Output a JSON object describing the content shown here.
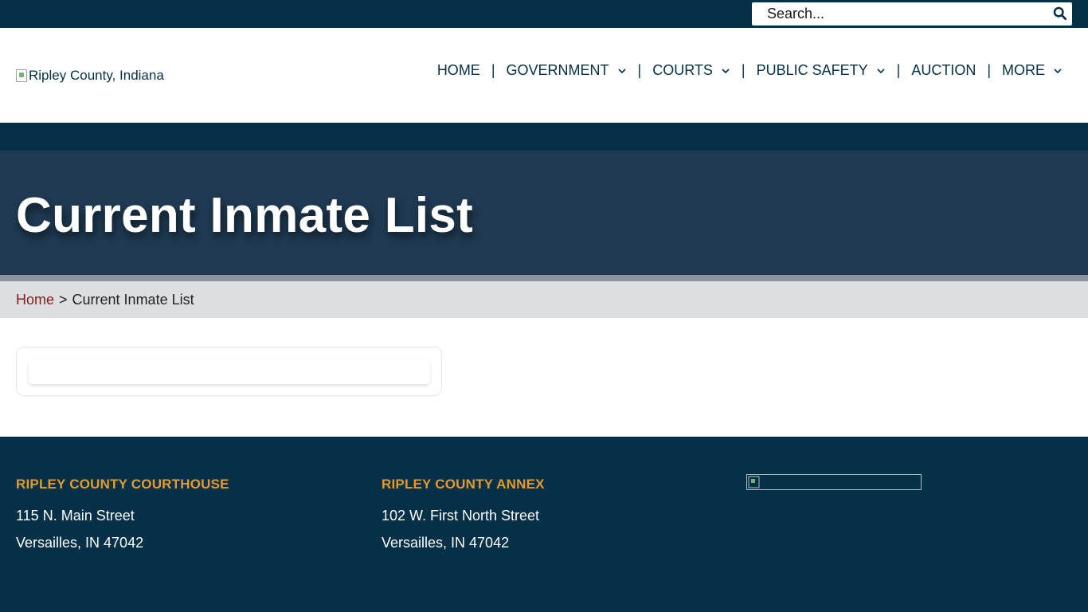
{
  "search": {
    "placeholder": "Search..."
  },
  "logo": {
    "alt_text": "Ripley County, Indiana"
  },
  "nav": {
    "items": [
      {
        "label": "HOME",
        "has_dropdown": false
      },
      {
        "label": "GOVERNMENT",
        "has_dropdown": true
      },
      {
        "label": "COURTS",
        "has_dropdown": true
      },
      {
        "label": "PUBLIC SAFETY",
        "has_dropdown": true
      },
      {
        "label": "AUCTION",
        "has_dropdown": false
      },
      {
        "label": "MORE",
        "has_dropdown": true
      }
    ],
    "separator": "|"
  },
  "page": {
    "title": "Current Inmate List"
  },
  "breadcrumb": {
    "home": "Home",
    "separator": ">",
    "current": "Current Inmate List"
  },
  "footer": {
    "courthouse": {
      "heading": "RIPLEY COUNTY COURTHOUSE",
      "address1": "115 N. Main Street",
      "address2": "Versailles, IN 47042"
    },
    "annex": {
      "heading": "RIPLEY COUNTY ANNEX",
      "address1": "102 W. First North Street",
      "address2": "Versailles, IN 47042"
    }
  },
  "colors": {
    "navy": "#043048",
    "hero": "#1f3a52",
    "accent_orange": "#e69a2e",
    "link_red": "#8b1a1a",
    "breadcrumb_bg": "#dcdfe2"
  },
  "icons": {
    "search": "search-icon",
    "dropdown": "chevron-down-icon"
  }
}
